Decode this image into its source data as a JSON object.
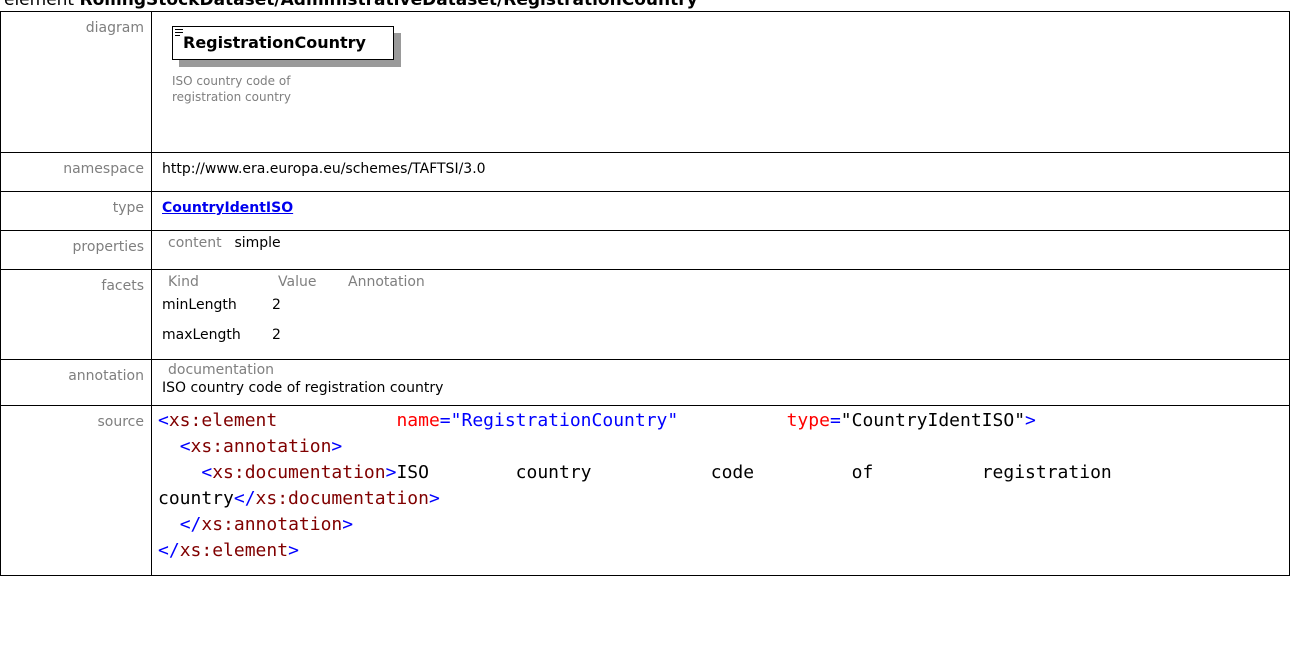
{
  "page_title": {
    "prefix": "element",
    "path": "RollingStockDataset/AdministrativeDataset/RegistrationCountry"
  },
  "labels": {
    "diagram": "diagram",
    "namespace": "namespace",
    "type": "type",
    "properties": "properties",
    "facets": "facets",
    "annotation": "annotation",
    "source": "source"
  },
  "diagram": {
    "element_name": "RegistrationCountry",
    "description_line1": "ISO country code of",
    "description_line2": "registration country"
  },
  "namespace": "http://www.era.europa.eu/schemes/TAFTSI/3.0",
  "type": "CountryIdentISO",
  "properties": {
    "key": "content",
    "value": "simple"
  },
  "facets": {
    "headers": [
      "Kind",
      "Value",
      "Annotation"
    ],
    "rows": [
      {
        "kind": "minLength",
        "value": "2"
      },
      {
        "kind": "maxLength",
        "value": "2"
      }
    ]
  },
  "annotation": {
    "header": "documentation",
    "value": "ISO country code of registration country"
  },
  "source": {
    "line1_tag": "xs:element",
    "line1_attr1_name": "name",
    "line1_attr1_value": "\"RegistrationCountry\"",
    "line1_attr2_name": "type",
    "line1_attr2_value": "\"CountryIdentISO\"",
    "line2_tag": "xs:annotation",
    "line3_tag": "xs:documentation",
    "line3_text_parts": [
      "ISO",
      "country",
      "code",
      "of",
      "registration"
    ],
    "line4_text": "country",
    "line4_close_tag": "xs:documentation",
    "line5_close_tag": "xs:annotation",
    "line6_close_tag": "xs:element"
  }
}
